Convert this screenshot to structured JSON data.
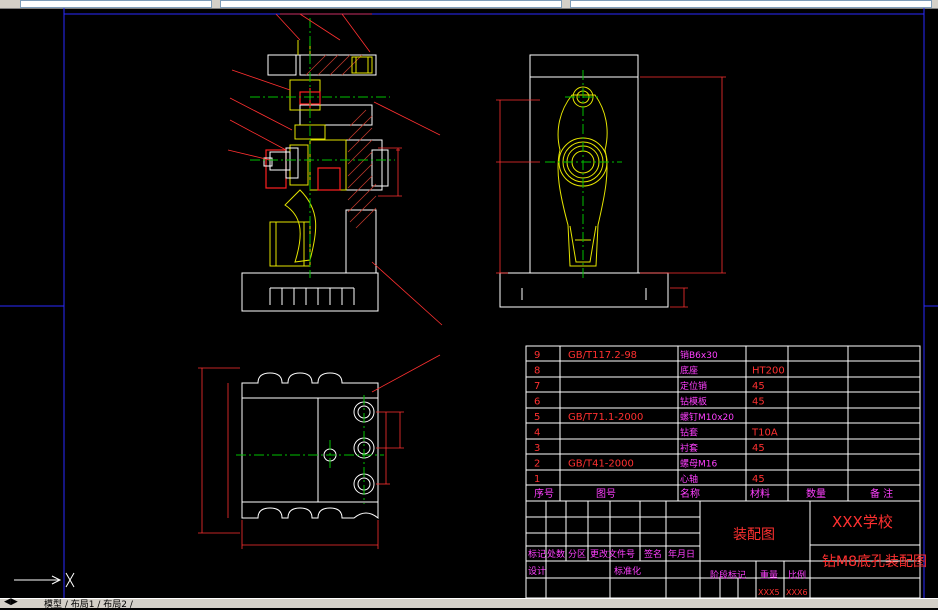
{
  "colors": {
    "background": "#000000",
    "outline": "#ffffff",
    "frame": "#2a2aff",
    "center_line": "#00c000",
    "hatch": "#c0392b",
    "part_yellow": "#e5e500",
    "part_red": "#ff2020",
    "dimension": "#ff3030",
    "table_text_red": "#ff3030",
    "table_text_magenta": "#ff40ff"
  },
  "bom": {
    "rows": [
      {
        "no": "9",
        "code": "GB/T117.2-98",
        "name": "销B6x30",
        "material": ""
      },
      {
        "no": "8",
        "code": "",
        "name": "底座",
        "material": "HT200"
      },
      {
        "no": "7",
        "code": "",
        "name": "定位销",
        "material": "45"
      },
      {
        "no": "6",
        "code": "",
        "name": "钻模板",
        "material": "45"
      },
      {
        "no": "5",
        "code": "GB/T71.1-2000",
        "name": "螺钉M10x20",
        "material": ""
      },
      {
        "no": "4",
        "code": "",
        "name": "钻套",
        "material": "T10A"
      },
      {
        "no": "3",
        "code": "",
        "name": "衬套",
        "material": "45"
      },
      {
        "no": "2",
        "code": "GB/T41-2000",
        "name": "螺母M16",
        "material": ""
      },
      {
        "no": "1",
        "code": "",
        "name": "心轴",
        "material": "45"
      }
    ],
    "header": {
      "no": "序号",
      "code": "图号",
      "name": "名称",
      "material": "材料",
      "qty": "数量",
      "remark": "备 注"
    }
  },
  "title_block": {
    "drawing_kind": "装配图",
    "school": "XXX学校",
    "drawing_title": "钻M8底孔装配图",
    "rev_labels": [
      "标记",
      "处数",
      "分区",
      "更改文件号",
      "签名",
      "年月日"
    ],
    "designer_label": "设计",
    "standardization_label": "标准化",
    "stage_label": "阶段标记",
    "weight_label": "重量",
    "scale_label": "比例",
    "weight_value": "XXX5",
    "scale_value": "XXX6"
  },
  "statusbar": {
    "tabs_text": "模型 / 布局1 / 布局2 /"
  }
}
